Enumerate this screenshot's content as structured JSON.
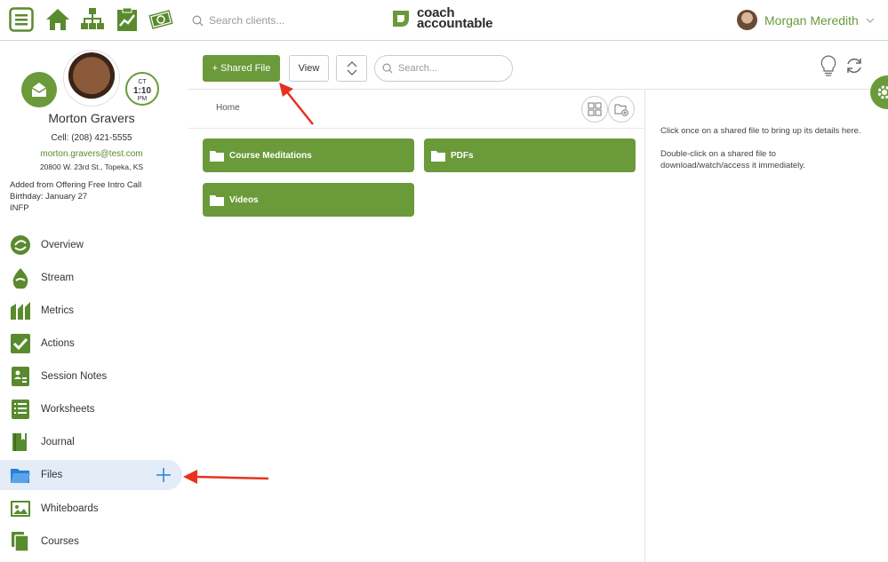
{
  "topbar": {
    "icons": [
      "menu-icon",
      "home-icon",
      "org-chart-icon",
      "chart-clipboard-icon",
      "money-icon"
    ],
    "search_placeholder": "Search clients...",
    "logo_line1": "coach",
    "logo_line2": "accountable",
    "user_name": "Morgan Meredith"
  },
  "profile": {
    "timezone": "CT",
    "time": "1:10",
    "ampm": "PM",
    "name": "Morton Gravers",
    "cell": "Cell:  (208) 421-5555",
    "email": "morton.gravers@test.com",
    "address": "20800 W. 23rd St., Topeka, KS",
    "notes": [
      "Added from Offering Free Intro Call",
      "Birthday: January 27",
      "INFP"
    ]
  },
  "nav": [
    {
      "label": "Overview",
      "icon": "overview-icon"
    },
    {
      "label": "Stream",
      "icon": "stream-icon"
    },
    {
      "label": "Metrics",
      "icon": "metrics-icon"
    },
    {
      "label": "Actions",
      "icon": "actions-icon"
    },
    {
      "label": "Session Notes",
      "icon": "session-notes-icon"
    },
    {
      "label": "Worksheets",
      "icon": "worksheets-icon"
    },
    {
      "label": "Journal",
      "icon": "journal-icon"
    },
    {
      "label": "Files",
      "icon": "files-icon",
      "active": true
    },
    {
      "label": "Whiteboards",
      "icon": "whiteboards-icon"
    },
    {
      "label": "Courses",
      "icon": "courses-icon"
    }
  ],
  "toolbar": {
    "shared_file_label": "+ Shared File",
    "view_label": "View",
    "search_placeholder": "Search..."
  },
  "files": {
    "breadcrumb": "Home",
    "folders": [
      "Course Meditations",
      "PDFs",
      "Videos"
    ]
  },
  "detail": {
    "line1": "Click once on a shared file to bring up its details here.",
    "line2": "Double-click on a shared file to download/watch/access it immediately."
  },
  "colors": {
    "accent": "#6a9a3a",
    "arrow": "#e8321e",
    "active_bg": "#e3ecf7"
  }
}
